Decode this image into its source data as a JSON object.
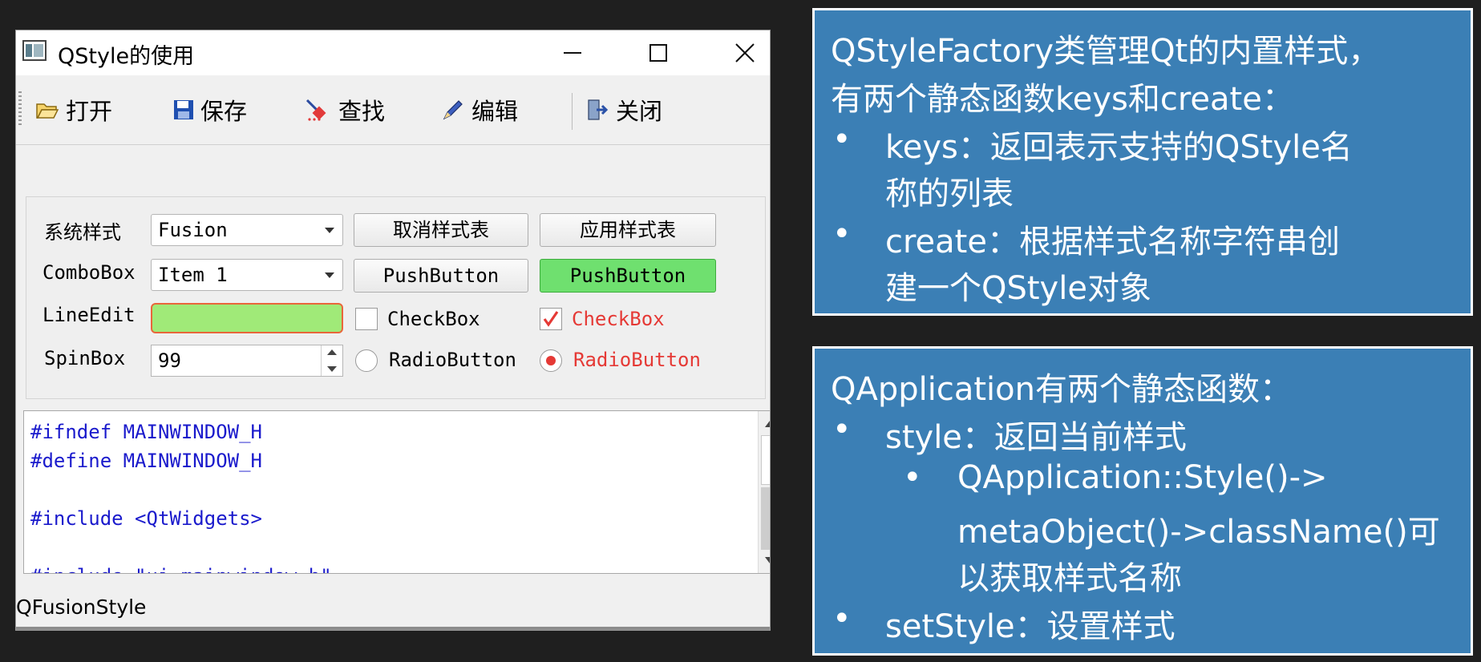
{
  "window": {
    "title": "QStyle的使用",
    "controls": {
      "minimize": "minimize-icon",
      "maximize": "maximize-icon",
      "close": "close-icon"
    }
  },
  "toolbar": {
    "items": [
      {
        "label": "打开",
        "icon": "folder-open-icon"
      },
      {
        "label": "保存",
        "icon": "floppy-disk-icon"
      },
      {
        "label": "查找",
        "icon": "find-icon"
      },
      {
        "label": "编辑",
        "icon": "pen-icon"
      },
      {
        "label": "关闭",
        "icon": "exit-door-icon"
      }
    ]
  },
  "form": {
    "style_label": "系统样式",
    "style_value": "Fusion",
    "cancel_stylesheet": "取消样式表",
    "apply_stylesheet": "应用样式表",
    "combobox_label": "ComboBox",
    "combobox_value": "Item 1",
    "pushbutton_normal": "PushButton",
    "pushbutton_styled": "PushButton",
    "lineedit_label": "LineEdit",
    "lineedit_value": "",
    "checkbox_normal": "CheckBox",
    "checkbox_styled": "CheckBox",
    "spinbox_label": "SpinBox",
    "spinbox_value": "99",
    "radio_normal": "RadioButton",
    "radio_styled": "RadioButton",
    "checkbox_styled_checked": true,
    "radio_styled_checked": true
  },
  "editor": {
    "lines": [
      "#ifndef MAINWINDOW_H",
      "#define MAINWINDOW_H",
      "",
      "#include <QtWidgets>",
      "",
      "#include \"ui_mainwindow.h\""
    ]
  },
  "status": {
    "text": "QFusionStyle"
  },
  "slide1": {
    "line1": "QStyleFactory类管理Qt的内置样式，",
    "line2": "有两个静态函数keys和create：",
    "b1_line1": "keys：返回表示支持的QStyle名",
    "b1_line2": "称的列表",
    "b2_line1": "create：根据样式名称字符串创",
    "b2_line2": "建一个QStyle对象",
    "bullet": "•"
  },
  "slide2": {
    "line1": "QApplication有两个静态函数：",
    "b1": "style：返回当前样式",
    "sub_line1": "QApplication::Style()->",
    "sub_line2": "metaObject()->className()可",
    "sub_line3": "以获取样式名称",
    "b2": "setStyle：设置样式",
    "bullet": "•"
  },
  "colors": {
    "slide_bg": "#3b7fb5",
    "green_button": "#6fe06f",
    "lineedit_fill": "#a0ea78",
    "lineedit_border": "#e8663a",
    "styled_red": "#e53935",
    "code_blue": "#1a1acc"
  }
}
